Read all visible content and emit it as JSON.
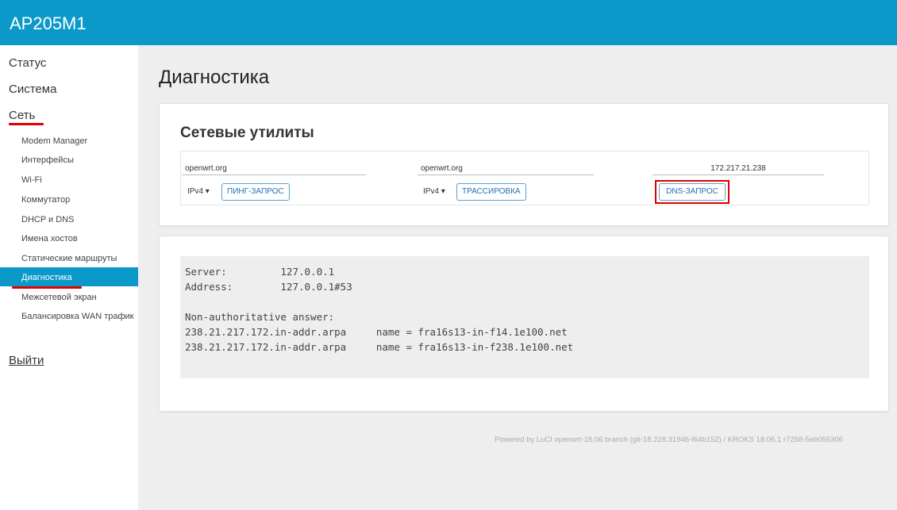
{
  "app": {
    "title": "AP205M1"
  },
  "sidebar": {
    "top_items": [
      {
        "label": "Статус"
      },
      {
        "label": "Система"
      },
      {
        "label": "Сеть"
      }
    ],
    "sub_items": [
      {
        "label": "Modem Manager"
      },
      {
        "label": "Интерфейсы"
      },
      {
        "label": "Wi-Fi"
      },
      {
        "label": "Коммутатор"
      },
      {
        "label": "DHCP и DNS"
      },
      {
        "label": "Имена хостов"
      },
      {
        "label": "Статические маршруты"
      },
      {
        "label": "Диагностика"
      },
      {
        "label": "Межсетевой экран"
      },
      {
        "label": "Балансировка WAN трафик"
      }
    ],
    "logout": "Выйти"
  },
  "page": {
    "title": "Диагностика"
  },
  "tools": {
    "section_title": "Сетевые утилиты",
    "ping": {
      "value": "openwrt.org",
      "protocol": "IPv4 ▾",
      "button": "ПИНГ-ЗАПРОС"
    },
    "traceroute": {
      "value": "openwrt.org",
      "protocol": "IPv4 ▾",
      "button": "ТРАССИРОВКА"
    },
    "dns": {
      "value": "172.217.21.238",
      "button": "DNS-ЗАПРОС"
    }
  },
  "output": {
    "lines": [
      "Server:         127.0.0.1",
      "Address:        127.0.0.1#53",
      "",
      "Non-authoritative answer:",
      "238.21.217.172.in-addr.arpa     name = fra16s13-in-f14.1e100.net",
      "238.21.217.172.in-addr.arpa     name = fra16s13-in-f238.1e100.net"
    ]
  },
  "footer": "Powered by LuCI openwrt-18.06 branch (git-18.228.31946-f64b152) / KROKS 18.06.1 r7258-5eb055306",
  "colors": {
    "accent": "#0a99c9",
    "highlight": "#e00000",
    "background": "#eeeeee"
  }
}
